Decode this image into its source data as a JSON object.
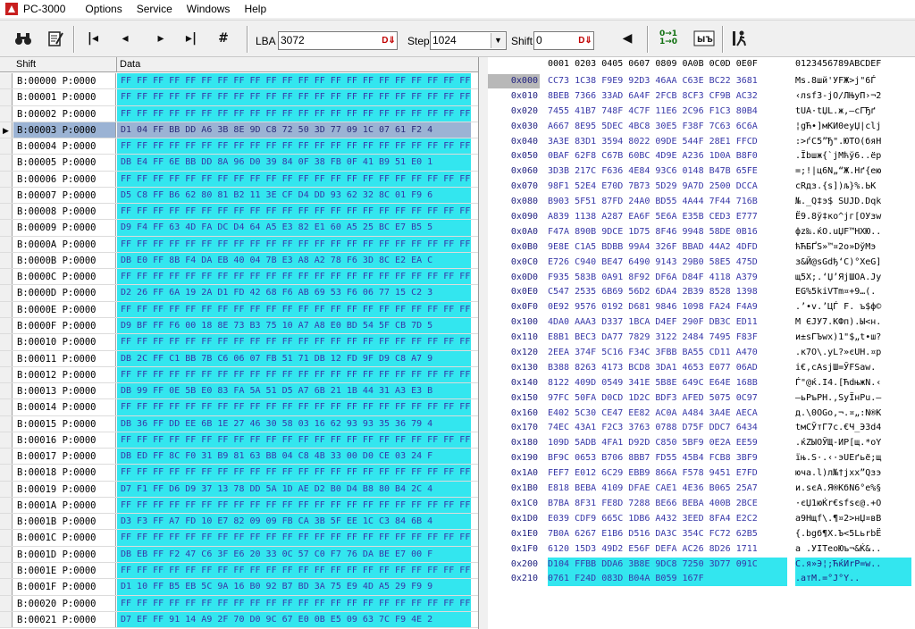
{
  "title": "PC-3000",
  "menu": [
    "Options",
    "Service",
    "Windows",
    "Help"
  ],
  "toolbar": {
    "lba_label": "LBA",
    "lba_value": "3072",
    "step_label": "Step",
    "step_value": "1024",
    "shift_label": "Shift",
    "shift_value": "0",
    "icons": [
      "binoculars-icon",
      "edit-icon",
      "first-icon",
      "prev-icon",
      "next-icon",
      "last-icon",
      "goto-icon",
      "left-arrow-icon",
      "copy-icon",
      "compare-icon",
      "run-icon"
    ]
  },
  "grid": {
    "col_shift": "Shift",
    "col_data": "Data",
    "rows": [
      {
        "addr": "B:00000 P:0000",
        "data": "FF FF FF FF FF FF FF FF FF FF FF FF FF FF FF FF FF FF FF FF FF FF FF F"
      },
      {
        "addr": "B:00001 P:0000",
        "data": "FF FF FF FF FF FF FF FF FF FF FF FF FF FF FF FF FF FF FF FF FF FF FF F"
      },
      {
        "addr": "B:00002 P:0000",
        "data": "FF FF FF FF FF FF FF FF FF FF FF FF FF FF FF FF FF FF FF FF FF FF FF F"
      },
      {
        "addr": "B:00003 P:0000",
        "data": "D1 04 FF BB DD A6 3B 8E 9D C8 72 50 3D 77 09 1C 07 61 F2 4"
      },
      {
        "addr": "B:00004 P:0000",
        "data": "FF FF FF FF FF FF FF FF FF FF FF FF FF FF FF FF FF FF FF FF FF FF FF F"
      },
      {
        "addr": "B:00005 P:0000",
        "data": "DB E4 FF 6E BB DD 8A 96 D0 39 84 0F 38 FB 0F 41 B9 51 E0 1"
      },
      {
        "addr": "B:00006 P:0000",
        "data": "FF FF FF FF FF FF FF FF FF FF FF FF FF FF FF FF FF FF FF FF FF FF FF F"
      },
      {
        "addr": "B:00007 P:0000",
        "data": "D5 C8 FF B6 62 80 81 B2 11 3E CF D4 DD 93 62 32 8C 01 F9 6"
      },
      {
        "addr": "B:00008 P:0000",
        "data": "FF FF FF FF FF FF FF FF FF FF FF FF FF FF FF FF FF FF FF FF FF FF FF F"
      },
      {
        "addr": "B:00009 P:0000",
        "data": "D9 F4 FF 63 4D FA DC D4 64 A5 E3 82 E1 60 A5 25 BC E7 B5 5"
      },
      {
        "addr": "B:0000A P:0000",
        "data": "FF FF FF FF FF FF FF FF FF FF FF FF FF FF FF FF FF FF FF FF FF FF FF F"
      },
      {
        "addr": "B:0000B P:0000",
        "data": "DB E0 FF 8B F4 DA EB 40 04 7B E3 A8 A2 78 F6 3D 8C E2 EA C"
      },
      {
        "addr": "B:0000C P:0000",
        "data": "FF FF FF FF FF FF FF FF FF FF FF FF FF FF FF FF FF FF FF FF FF FF FF F"
      },
      {
        "addr": "B:0000D P:0000",
        "data": "D2 26 FF 6A 19 2A D1 FD 42 68 F6 AB 69 53 F6 06 77 15 C2 3"
      },
      {
        "addr": "B:0000E P:0000",
        "data": "FF FF FF FF FF FF FF FF FF FF FF FF FF FF FF FF FF FF FF FF FF FF FF F"
      },
      {
        "addr": "B:0000F P:0000",
        "data": "D9 BF FF F6 00 18 8E 73 B3 75 10 A7 A8 E0 BD 54 5F CB 7D 5"
      },
      {
        "addr": "B:00010 P:0000",
        "data": "FF FF FF FF FF FF FF FF FF FF FF FF FF FF FF FF FF FF FF FF FF FF FF F"
      },
      {
        "addr": "B:00011 P:0000",
        "data": "DB 2C FF C1 BB 7B C6 06 07 FB 51 71 DB 12 FD 9F D9 C8 A7 9"
      },
      {
        "addr": "B:00012 P:0000",
        "data": "FF FF FF FF FF FF FF FF FF FF FF FF FF FF FF FF FF FF FF FF FF FF FF F"
      },
      {
        "addr": "B:00013 P:0000",
        "data": "DB 99 FF 0E 5B E0 83 FA 5A 51 D5 A7 6B 21 1B 44 31 A3 E3 B"
      },
      {
        "addr": "B:00014 P:0000",
        "data": "FF FF FF FF FF FF FF FF FF FF FF FF FF FF FF FF FF FF FF FF FF FF FF F"
      },
      {
        "addr": "B:00015 P:0000",
        "data": "DB 36 FF DD EE 6B 1E 27 46 30 58 03 16 62 93 93 35 36 79 4"
      },
      {
        "addr": "B:00016 P:0000",
        "data": "FF FF FF FF FF FF FF FF FF FF FF FF FF FF FF FF FF FF FF FF FF FF FF F"
      },
      {
        "addr": "B:00017 P:0000",
        "data": "DB ED FF 8C F0 31 B9 81 63 BB 04 C8 4B 33 00 D0 CE 03 24 F"
      },
      {
        "addr": "B:00018 P:0000",
        "data": "FF FF FF FF FF FF FF FF FF FF FF FF FF FF FF FF FF FF FF FF FF FF FF F"
      },
      {
        "addr": "B:00019 P:0000",
        "data": "D7 F1 FF D6 D9 37 13 78 DD 5A 1D AE D2 B0 D4 B8 80 B4 2C 4"
      },
      {
        "addr": "B:0001A P:0000",
        "data": "FF FF FF FF FF FF FF FF FF FF FF FF FF FF FF FF FF FF FF FF FF FF FF F"
      },
      {
        "addr": "B:0001B P:0000",
        "data": "D3 F3 FF A7 FD 10 E7 82 09 09 FB CA 3B 5F EE 1C C3 84 6B 4"
      },
      {
        "addr": "B:0001C P:0000",
        "data": "FF FF FF FF FF FF FF FF FF FF FF FF FF FF FF FF FF FF FF FF FF FF FF F"
      },
      {
        "addr": "B:0001D P:0000",
        "data": "DB EB FF F2 47 C6 3F E6 20 33 0C 57 C0 F7 76 DA BE E7 00 F"
      },
      {
        "addr": "B:0001E P:0000",
        "data": "FF FF FF FF FF FF FF FF FF FF FF FF FF FF FF FF FF FF FF FF FF FF FF F"
      },
      {
        "addr": "B:0001F P:0000",
        "data": "D1 10 FF B5 EB 5C 9A 16 B0 92 B7 BD 3A 75 E9 4D A5 29 F9 9"
      },
      {
        "addr": "B:00020 P:0000",
        "data": "FF FF FF FF FF FF FF FF FF FF FF FF FF FF FF FF FF FF FF FF FF FF FF F"
      },
      {
        "addr": "B:00021 P:0000",
        "data": "D7 EF FF 91 14 A9 2F 70 D0 9C 67 E0 0B E5 09 63 7C F9 4E 2"
      }
    ]
  },
  "hex": {
    "header": "0001 0203 0405 0607 0809 0A0B 0C0D 0E0F",
    "ascii_header": "0123456789ABCDEF",
    "rows": [
      {
        "addr": "0x000",
        "bytes": "CC73 1C38 F9E9 92D3 46AA C63E BC22 3681",
        "ascii": "Ms.8шй'УFЖ>ј\"6Ѓ"
      },
      {
        "addr": "0x010",
        "bytes": "8BEB 7366 33AD 6A4F 2FCB 8CF3 CF9B AC32",
        "ascii": "‹лsf3-jO/ЛЊуП›¬2"
      },
      {
        "addr": "0x020",
        "bytes": "7455 41B7 748F 4C7F 11E6 2C96 F1C3 80B4",
        "ascii": "tUA·tЏL.ж,–сГЂґ"
      },
      {
        "addr": "0x030",
        "bytes": "A667 8E95 5DEC 4BC8 30E5 F38F 7C63 6C6A",
        "ascii": "¦gЋ•]мKИ0еуЏ|clj"
      },
      {
        "addr": "0x040",
        "bytes": "3A3E 83D1 3594 8022 09DE 544F 28E1 FFCD",
        "ascii": ":>ѓС5”Ђ\".ЮTO(бяН"
      },
      {
        "addr": "0x050",
        "bytes": "0BAF 62F8 C67B 60BC 4D9E A236 1D0A B8F0",
        "ascii": ".Їbшж{`јMћў6..ёр"
      },
      {
        "addr": "0x060",
        "bytes": "3D3B 217C F636 4E84 93C6 0148 B47B 65FE",
        "ascii": "=;!|ц6N„“Ж.Hґ{eю"
      },
      {
        "addr": "0x070",
        "bytes": "98F1 52E4 E70D 7B73 5D29 9A7D 2500 DCCA",
        "ascii": "сRдз.{s])љ}%.ЬК"
      },
      {
        "addr": "0x080",
        "bytes": "B903 5F51 87FD 24A0 BD55 4A44 7F44 716B",
        "ascii": "№._Q‡э$ SUJD.Dqk"
      },
      {
        "addr": "0x090",
        "bytes": "A839 1138 A287 EA6F 5E6A E35B CED3 E777",
        "ascii": "Ё9.8ў‡кo^jг[ОУзw"
      },
      {
        "addr": "0x0A0",
        "bytes": "F47A 890B 9DCE 1D75 8F46 9948 58DE 0B16",
        "ascii": "фz‰.ќО.uЏF™HXЮ.."
      },
      {
        "addr": "0x0B0",
        "bytes": "9E8E C1A5 BDBB 99A4 326F BBAD 44A2 4DFD",
        "ascii": "ћЋБҐЅ»™¤2o»­DўMэ"
      },
      {
        "addr": "0x0C0",
        "bytes": "E726 C940 BE47 6490 9143 29B0 58E5 475D",
        "ascii": "з&Й@ѕGdђ‘C)°XеG]"
      },
      {
        "addr": "0x0D0",
        "bytes": "F935 583B 0A91 8F92 DF6A D84F 4118 A379",
        "ascii": "щ5X;.‘Џ’ЯjШOA.Јy"
      },
      {
        "addr": "0x0E0",
        "bytes": "C547 2535 6B69 56D2 6DA4 2B39 8528 1398",
        "ascii": "ЕG%5kiVТm¤+9…(."
      },
      {
        "addr": "0x0F0",
        "bytes": "0E92 9576 0192 D681 9846 1098 FA24 F4A9",
        "ascii": ".’•v.’ЦЃ F. ъ$ф©"
      },
      {
        "addr": "0x100",
        "bytes": "4DA0 AAA3 D337 1BCA D4EF 290F DB3C ED11",
        "ascii": "M ЄЈУ7.КФп).Ы<н."
      },
      {
        "addr": "0x110",
        "bytes": "E8B1 BEC3 DA77 7829 3122 2484 7495 F83F",
        "ascii": "и±ѕГЪwx)1\"$„t•ш?"
      },
      {
        "addr": "0x120",
        "bytes": "2EEA 374F 5C16 F34C 3FBB BA55 CD11 A470",
        "ascii": ".к7O\\.уL?»єUН.¤p"
      },
      {
        "addr": "0x130",
        "bytes": "B388 8263 4173 BCD8 3DA1 4653 E077 06AD",
        "ascii": "і€‚cAsјШ=ЎFSаw.­"
      },
      {
        "addr": "0x140",
        "bytes": "8122 409D 0549 341E 5B8E 649C E64E 168B",
        "ascii": "Ѓ\"@ќ.I4.[ЋdњжN.‹"
      },
      {
        "addr": "0x150",
        "bytes": "97FC 50FA D0CD 1D2C BDF3 AFED 5075 0C97",
        "ascii": "—ьPъРН.,ЅуЇнPu.—"
      },
      {
        "addr": "0x160",
        "bytes": "E402 5C30 CE47 EE82 AC0A A484 3A4E AECA",
        "ascii": "д.\\0ОGо‚¬.¤„:N®К"
      },
      {
        "addr": "0x170",
        "bytes": "74EC 43A1 F2C3 3763 0788 D75F DDC7 6434",
        "ascii": "tмCЎтГ7c.€Ч_ЭЗd4"
      },
      {
        "addr": "0x180",
        "bytes": "109D 5ADB 4FA1 D92D C850 5BF9 0E2A EE59",
        "ascii": ".ќZЫOЎЩ-ИP[щ.*оY"
      },
      {
        "addr": "0x190",
        "bytes": "BF9C 0653 B706 8BB7 FD55 45B4 FCB8 3BF9",
        "ascii": "їњ.S·.‹·эUEґьё;щ"
      },
      {
        "addr": "0x1A0",
        "bytes": "FEF7 E012 6C29 EBB9 866A F578 9451 E7FD",
        "ascii": "юча.l)л№†jхx”Qзэ"
      },
      {
        "addr": "0x1B0",
        "bytes": "E818 BEBA 4109 DFAE CAE1 4E36 B065 25A7",
        "ascii": "и.ѕєA.Я®КбN6°e%§"
      },
      {
        "addr": "0x1C0",
        "bytes": "B7BA 8F31 FE8D 7288 BE66 BEBA 400B 2BCE",
        "ascii": "·єЏ1юЌr€ѕfѕє@.+О"
      },
      {
        "addr": "0x1D0",
        "bytes": "E039 CDF9 665C 1DB6 A432 3EED 8FA4 E2C2",
        "ascii": "а9Нщf\\.¶¤2>нЏ¤вВ"
      },
      {
        "addr": "0x1E0",
        "bytes": "7B0A 6267 E1B6 D516 DA3C 354C FC72 62B5",
        "ascii": "{.bgб¶Х.Ъ<5LьrbЁ"
      },
      {
        "addr": "0x1F0",
        "bytes": "6120 15D3 49D2 E56F DEFA AC26 8D26 1711",
        "ascii": "a .УIТеoЮъ¬&Ќ&.."
      },
      {
        "addr": "0x200",
        "bytes": "D104 FFBB DDA6 3B8E 9DC8 7250 3D77 091C",
        "ascii": "С.я»Э¦;ЋќИrP=w.."
      },
      {
        "addr": "0x210",
        "bytes": "0761 F24D 083D B04A B059 167F",
        "ascii": ".aтM.=°J°Y.."
      }
    ]
  },
  "colors": {
    "data_bg": "#33e6ef",
    "selected_row": "#9bb3d4",
    "hex_text": "#3838a8"
  }
}
